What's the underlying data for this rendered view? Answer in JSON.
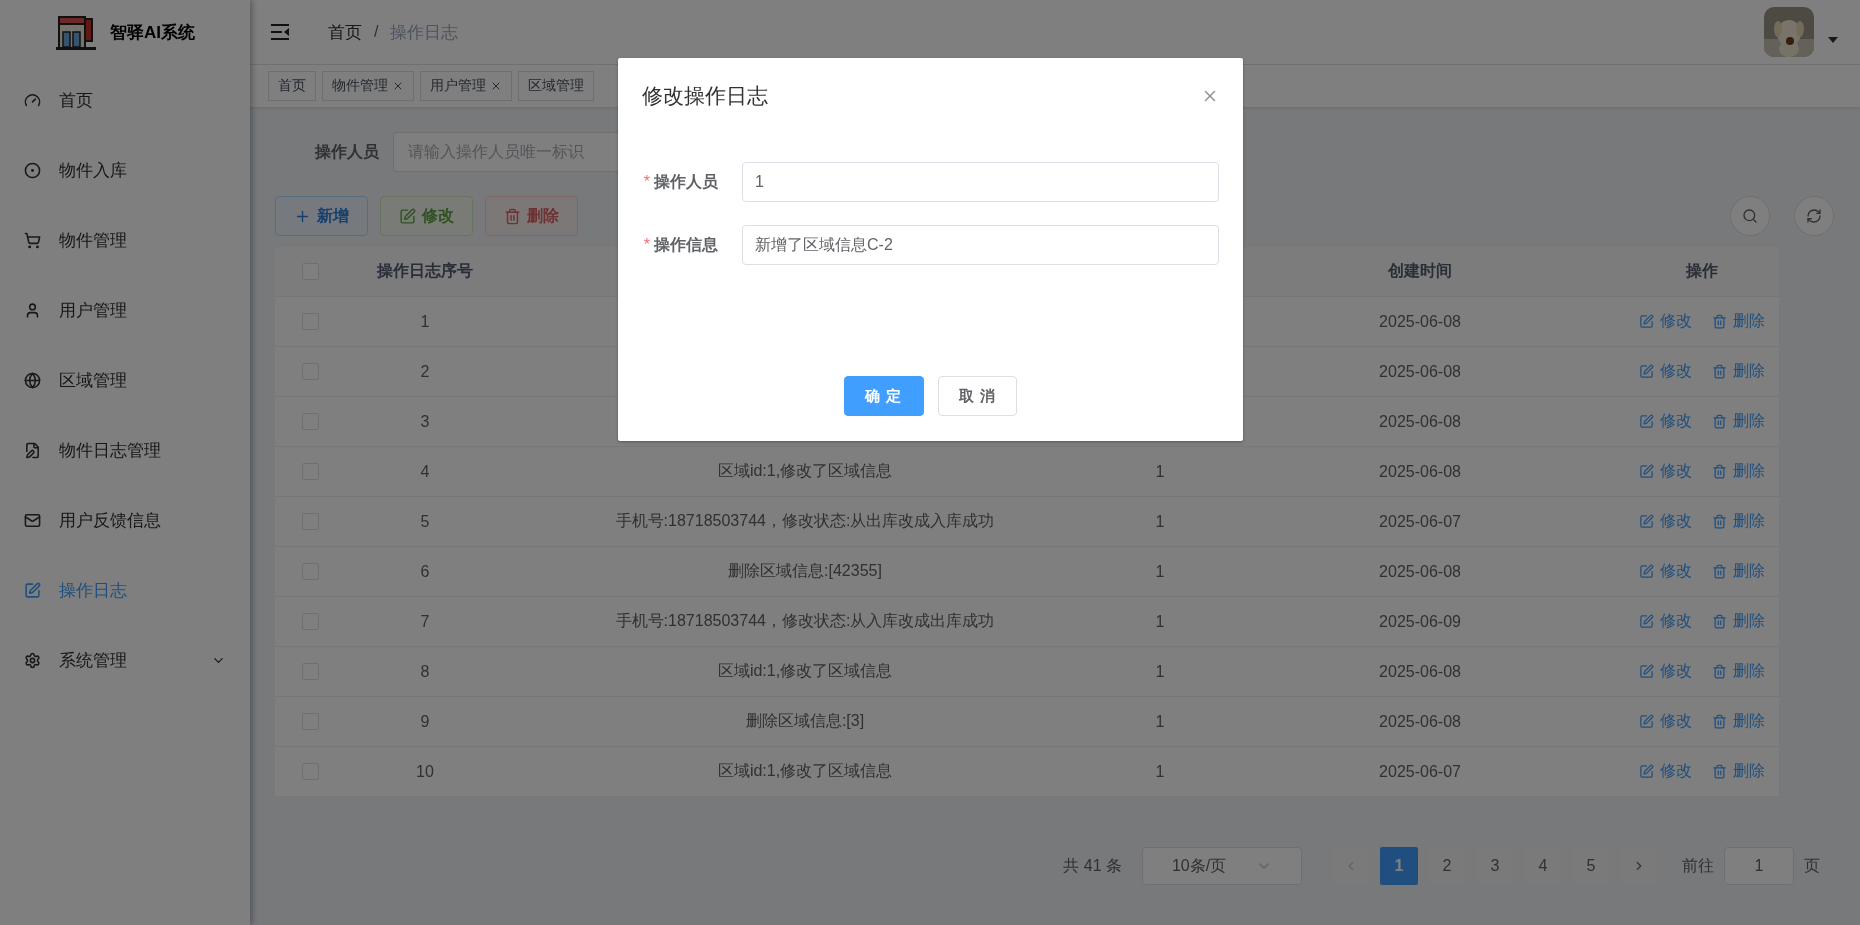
{
  "sidebar": {
    "title": "智驿AI系统",
    "items": [
      {
        "label": "首页",
        "selected": false
      },
      {
        "label": "物件入库",
        "selected": false
      },
      {
        "label": "物件管理",
        "selected": false
      },
      {
        "label": "用户管理",
        "selected": false
      },
      {
        "label": "区域管理",
        "selected": false
      },
      {
        "label": "物件日志管理",
        "selected": false
      },
      {
        "label": "用户反馈信息",
        "selected": false
      },
      {
        "label": "操作日志",
        "selected": true
      },
      {
        "label": "系统管理",
        "selected": false,
        "expanded": false
      }
    ]
  },
  "breadcrumb": {
    "items": [
      "首页",
      "操作日志"
    ],
    "separator": "/"
  },
  "tags": [
    {
      "label": "首页",
      "closable": false
    },
    {
      "label": "物件管理",
      "closable": true
    },
    {
      "label": "用户管理",
      "closable": true
    },
    {
      "label": "区域管理",
      "closable": false
    }
  ],
  "search": {
    "label": "操作人员",
    "placeholder": "请输入操作人员唯一标识"
  },
  "toolbar": [
    {
      "kind": "add",
      "label": "新增",
      "disabled": false
    },
    {
      "kind": "edit",
      "label": "修改",
      "disabled": true
    },
    {
      "kind": "delete",
      "label": "删除",
      "disabled": true
    }
  ],
  "table": {
    "columns": [
      null,
      "操作日志序号",
      null,
      null,
      "创建时间",
      "操作"
    ],
    "rows": [
      {
        "checked": false,
        "id": "1",
        "created": "2025-06-08",
        "actions": [
          "修改",
          "删除"
        ]
      },
      {
        "checked": false,
        "id": "2",
        "created": "2025-06-08",
        "actions": [
          "修改",
          "删除"
        ]
      },
      {
        "checked": false,
        "id": "3",
        "created": "2025-06-08",
        "actions": [
          "修改",
          "删除"
        ]
      },
      {
        "checked": false,
        "id": "4",
        "message": "区域id:1,修改了区域信息",
        "operator": "1",
        "created": "2025-06-08",
        "actions": [
          "修改",
          "删除"
        ]
      },
      {
        "checked": false,
        "id": "5",
        "message": "手机号:18718503744，修改状态:从出库改成入库成功",
        "operator": "1",
        "created": "2025-06-07",
        "actions": [
          "修改",
          "删除"
        ]
      },
      {
        "checked": false,
        "id": "6",
        "message": "删除区域信息:[42355]",
        "operator": "1",
        "created": "2025-06-08",
        "actions": [
          "修改",
          "删除"
        ]
      },
      {
        "checked": false,
        "id": "7",
        "message": "手机号:18718503744，修改状态:从入库改成出库成功",
        "operator": "1",
        "created": "2025-06-09",
        "actions": [
          "修改",
          "删除"
        ]
      },
      {
        "checked": false,
        "id": "8",
        "message": "区域id:1,修改了区域信息",
        "operator": "1",
        "created": "2025-06-08",
        "actions": [
          "修改",
          "删除"
        ]
      },
      {
        "checked": false,
        "id": "9",
        "message": "删除区域信息:[3]",
        "operator": "1",
        "created": "2025-06-08",
        "actions": [
          "修改",
          "删除"
        ]
      },
      {
        "checked": false,
        "id": "10",
        "message": "区域id:1,修改了区域信息",
        "operator": "1",
        "created": "2025-06-07",
        "actions": [
          "修改",
          "删除"
        ]
      }
    ],
    "header_checked": false
  },
  "pagination": {
    "total": "共 41 条",
    "page_size": "10条/页",
    "pages": [
      {
        "label": "1",
        "selected": true
      },
      {
        "label": "2",
        "selected": false
      },
      {
        "label": "3",
        "selected": false
      },
      {
        "label": "4",
        "selected": false
      },
      {
        "label": "5",
        "selected": false
      }
    ],
    "goto_label": "前往",
    "goto_value": "1",
    "goto_suffix": "页"
  },
  "dialog": {
    "title": "修改操作日志",
    "fields": [
      {
        "label": "操作人员",
        "required": true,
        "value": "1"
      },
      {
        "label": "操作信息",
        "required": true,
        "value": "新增了区域信息C-2"
      }
    ],
    "required_mark": "*",
    "confirm": "确 定",
    "cancel": "取 消"
  }
}
